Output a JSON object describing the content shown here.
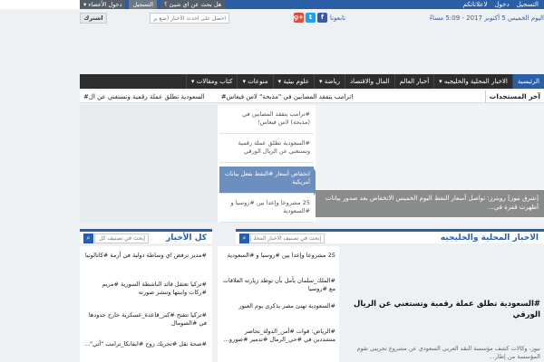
{
  "topbar": {
    "links": [
      "التسجيل",
      "دخول",
      "لاعلاناتكم"
    ],
    "question": "هل بحث عن اي شيئ ؟",
    "register": "التسجيل",
    "login": "دخول الأعضاء"
  },
  "header": {
    "date": "اليوم الخميس 5 أكتوبر 2017 - 5:09 مساءً",
    "follow": "تابعونا",
    "search_placeholder": "احصل على احدث الأخبار (ضع بريدك هنا)",
    "subscribe": "اشترك"
  },
  "icons": {
    "facebook": "f",
    "twitter": "t",
    "gplus": "g+"
  },
  "nav": {
    "items": [
      "الرئيسية",
      "الاخبار المحلية والخليجيه",
      "أخبار العالم",
      "المال والاقتصاد",
      "رياضة",
      "علوم بيئية",
      "منوعات",
      "كتاب ومقالات"
    ]
  },
  "ticker": {
    "label": "آخر المستجدات",
    "item1": "#ترامب يتفقد المصابين في \"مذبحة\" لاس فيغاس!",
    "item2": "#السعودية تطلق عملة رقمية وتستغني عن ال"
  },
  "slider": {
    "items": [
      "#ترامب يتفقد المصابين في (مذبحة) لاس فيغاس!",
      "#السعودية تطلق عملة رقمية وتستغني عن الريال الورقي",
      "انخفاض أسعار #النفط بفعل بيانات أمريكية",
      "25 مشروعا وإعدا بين #روسيا و #السعودية"
    ],
    "hero_caption": "[شرق نيوز] رويترز: تواصل أسعار النفط اليوم الخميس الانخفاض بعد صدور بيانات أظهرت قفزة في..."
  },
  "sections": {
    "local": {
      "title": "الاخبار المحلية والخليجيه",
      "search_placeholder": "إبحث في تصنيف الاخبار المحلية"
    },
    "all": {
      "title": "كل الأخبار",
      "search_placeholder": "إبحث في تصنيف كل الأخبار"
    }
  },
  "local_news": [
    "25 مشروعا وإعدا بين #روسيا و #السعودية",
    "#الملك_سلمان يأمل بأن توطد زيارته العلاقات مع #روسيا",
    "#السعودية تهنئ مصر بذكرى يوم العبور",
    "#الرياض: قوات #أمن_الدولة_تحاصر متشددين في #حي_الرمال #تدمير #صورو..."
  ],
  "featured": {
    "title": "#السعودية تطلق عملة رقمية وتستغني عن الريال الورقي",
    "body": "نيوز، وكالات كشف مؤسسة النقد العربي السعودي عن مشروع تجريبي تقوم المؤسسة من إطار..."
  },
  "all_news": [
    "#مدير ترفض اي وساطة دولية في أزمة #كاتالونيا",
    "#تركيا تعتقل قائد الناشطة السورية #مريم #ركات وابنتها وتنشر صورته",
    "#تركيا تتفتح #كبر_قاعدة_عسكرية خارج حدودها في #الصومال",
    "#صحة نقل #تحريك زوج #ايفانكا_ترامب \"آتي\"..."
  ]
}
